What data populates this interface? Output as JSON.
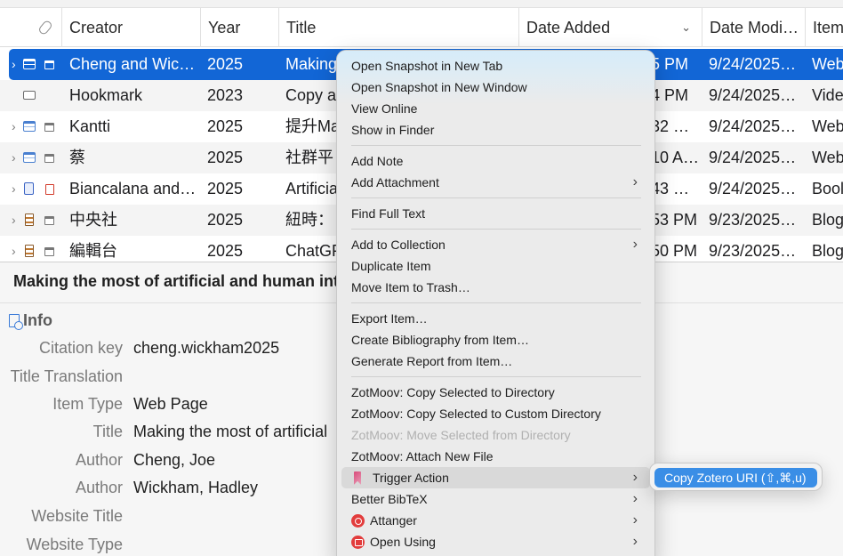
{
  "table": {
    "columns": [
      {
        "label": ""
      },
      {
        "label": "Creator"
      },
      {
        "label": "Year"
      },
      {
        "label": "Title"
      },
      {
        "label": "Date Added"
      },
      {
        "label": "Date Modi…"
      },
      {
        "label": "Item"
      }
    ],
    "rows": [
      {
        "creator": "Cheng and Wic…",
        "year": "2025",
        "title": "Making",
        "date_added": "5 PM",
        "date_modified": "9/24/2025…",
        "item_type": "Web"
      },
      {
        "creator": "Hookmark",
        "year": "2023",
        "title": "Copy a",
        "date_added": "4 PM",
        "date_modified": "9/24/2025…",
        "item_type": "Vide"
      },
      {
        "creator": "Kantti",
        "year": "2025",
        "title": "提升Ma",
        "date_added": "32 …",
        "date_modified": "9/24/2025…",
        "item_type": "Web"
      },
      {
        "creator": "蔡",
        "year": "2025",
        "title": "社群平",
        "date_added": "10 A…",
        "date_modified": "9/24/2025…",
        "item_type": "Web"
      },
      {
        "creator": "Biancalana and…",
        "year": "2025",
        "title": "Artificia",
        "date_added": "43 …",
        "date_modified": "9/24/2025…",
        "item_type": "Bool"
      },
      {
        "creator": "中央社",
        "year": "2025",
        "title": "紐時：",
        "date_added": "53 PM",
        "date_modified": "9/23/2025…",
        "item_type": "Blog"
      },
      {
        "creator": "編輯台",
        "year": "2025",
        "title": "ChatGP",
        "date_added": "50 PM",
        "date_modified": "9/23/2025…",
        "item_type": "Blog"
      }
    ]
  },
  "item_pane": {
    "title": "Making the most of artificial and human inte",
    "section": "Info",
    "fields": [
      {
        "label": "Citation key",
        "value": "cheng.wickham2025"
      },
      {
        "label": "Title Translation",
        "value": ""
      },
      {
        "label": "Item Type",
        "value": "Web Page"
      },
      {
        "label": "Title",
        "value": "Making the most of artificial"
      },
      {
        "label": "Author",
        "value": "Cheng, Joe"
      },
      {
        "label": "Author",
        "value": "Wickham, Hadley"
      },
      {
        "label": "Website Title",
        "value": ""
      },
      {
        "label": "Website Type",
        "value": ""
      }
    ]
  },
  "context_menu": {
    "items": [
      {
        "label": "Open Snapshot in New Tab"
      },
      {
        "label": "Open Snapshot in New Window"
      },
      {
        "label": "View Online"
      },
      {
        "label": "Show in Finder"
      },
      {
        "label": "Add Note"
      },
      {
        "label": "Add Attachment",
        "arrow": "›"
      },
      {
        "label": "Find Full Text"
      },
      {
        "label": "Add to Collection",
        "arrow": "›"
      },
      {
        "label": "Duplicate Item"
      },
      {
        "label": "Move Item to Trash…"
      },
      {
        "label": "Export Item…"
      },
      {
        "label": "Create Bibliography from Item…"
      },
      {
        "label": "Generate Report from Item…"
      },
      {
        "label": "ZotMoov: Copy Selected to Directory"
      },
      {
        "label": "ZotMoov: Copy Selected to Custom Directory"
      },
      {
        "label": "ZotMoov: Move Selected from Directory"
      },
      {
        "label": "ZotMoov: Attach New File"
      },
      {
        "label": "Trigger Action",
        "arrow": "›"
      },
      {
        "label": "Better BibTeX",
        "arrow": "›"
      },
      {
        "label": "Attanger",
        "arrow": "›"
      },
      {
        "label": "Open Using",
        "arrow": "›"
      }
    ]
  },
  "submenu": {
    "item": "Copy Zotero URI (⇧,⌘,u)"
  },
  "colors": {
    "selection": "#1266d6",
    "submenu_highlight": "#3a8ee6"
  }
}
